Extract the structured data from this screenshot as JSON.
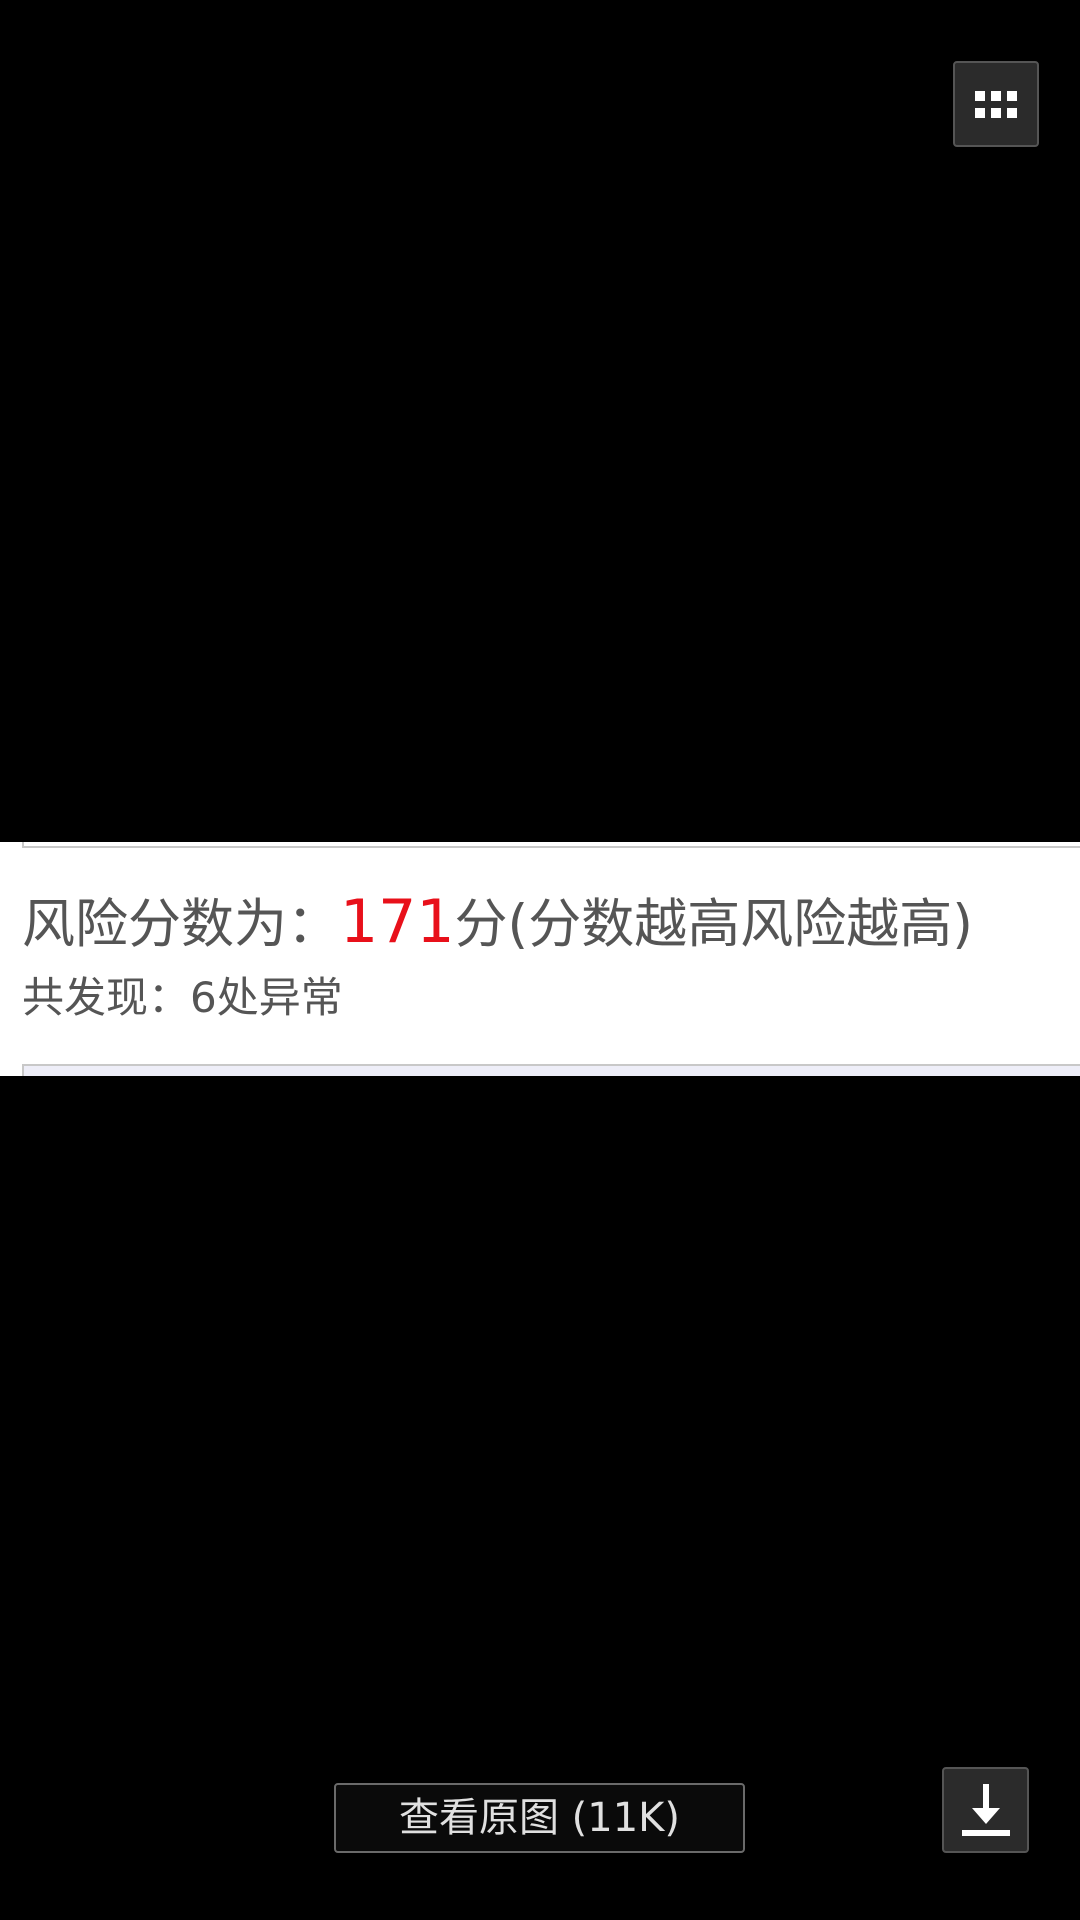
{
  "toolbar": {
    "menu_icon": "grid-menu-icon",
    "download_icon": "download-icon"
  },
  "image_content": {
    "score_prefix": "风险分数为：",
    "score_value": "171",
    "score_suffix": "分(分数越高风险越高)",
    "found_text": "共发现：6处异常"
  },
  "footer": {
    "view_original_label": "查看原图 (11K)"
  },
  "colors": {
    "background": "#000000",
    "score_highlight": "#e8101a",
    "text_gray": "#555555"
  }
}
